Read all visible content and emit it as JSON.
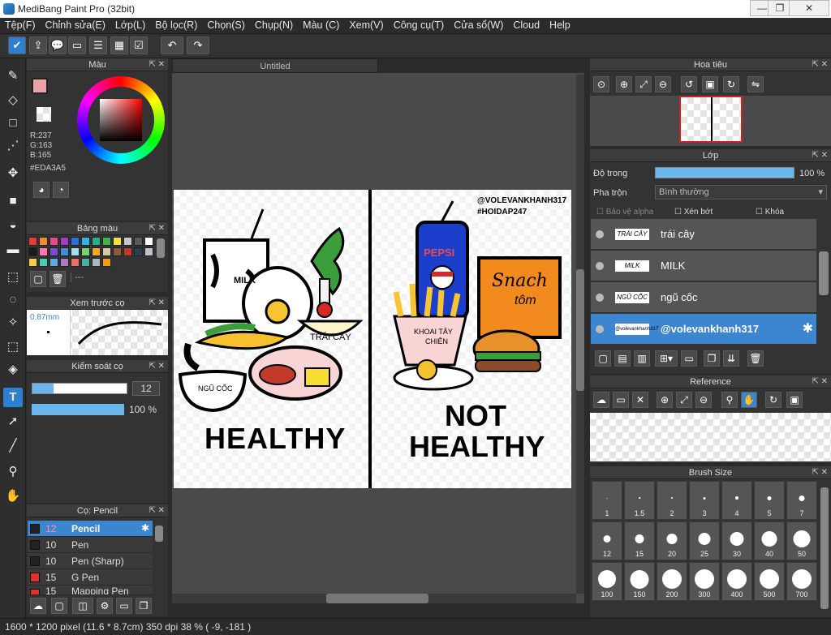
{
  "app": {
    "title": "MediBang Paint Pro (32bit)"
  },
  "menu": [
    "Tệp(F)",
    "Chỉnh sửa(E)",
    "Lớp(L)",
    "Bộ lọc(R)",
    "Chọn(S)",
    "Chụp(N)",
    "Màu (C)",
    "Xem(V)",
    "Công cụ(T)",
    "Cửa sổ(W)",
    "Cloud",
    "Help"
  ],
  "color_panel": {
    "title": "Màu",
    "r": "R:237",
    "g": "G:163",
    "b": "B:165",
    "hex": "#EDA3A5",
    "fg": "#EDA3A5"
  },
  "palette_panel": {
    "title": "Bảng màu",
    "dash": "---",
    "swatches": [
      "#e63b3b",
      "#f28a2e",
      "#e84b8a",
      "#9b3fc4",
      "#2d6fd6",
      "#2bb5e8",
      "#26b08a",
      "#3bb54a",
      "#f5e33b",
      "#c7c7c7",
      "#5a5a5a",
      "#ffffff",
      "#1a1a1a",
      "#ff7ab0",
      "#7a4bd6",
      "#3b8fd8",
      "#9fe0f0",
      "#77d177",
      "#f5a623",
      "#d4c8a0",
      "#8a5a3a",
      "#c0392b",
      "#2c3e50",
      "#bdc3c7",
      "#f4d03f",
      "#48c9b0",
      "#5dade2",
      "#af7ac5",
      "#ec7063",
      "#45b39d",
      "#aab7b8",
      "#f39c12"
    ]
  },
  "preview_panel": {
    "title": "Xem trước cọ",
    "size": "0.87mm"
  },
  "control_panel": {
    "title": "Kiểm soát cọ",
    "size": "12",
    "opacity": "100 %"
  },
  "brush_panel": {
    "title": "Cọ: Pencil",
    "items": [
      {
        "size": "12",
        "name": "Pencil",
        "color": "#222222",
        "selected": true
      },
      {
        "size": "10",
        "name": "Pen",
        "color": "#222222"
      },
      {
        "size": "10",
        "name": "Pen (Sharp)",
        "color": "#222222"
      },
      {
        "size": "15",
        "name": "G Pen",
        "color": "#e03030"
      },
      {
        "size": "15",
        "name": "Mapping Pen",
        "color": "#e03030"
      }
    ]
  },
  "document": {
    "tab": "Untitled",
    "healthy": "HEALTHY",
    "not_healthy_1": "NOT",
    "not_healthy_2": "HEALTHY",
    "handle_1": "@VOLEVANKHANH317",
    "handle_2": "#HOIDAP247",
    "milk": "MILK",
    "trai_cay": "TRÁI CÂY",
    "ngu_coc": "NGŨ CỐC",
    "pepsi": "PEPSI",
    "khoai_1": "KHOAI TÂY",
    "khoai_2": "CHIÊN",
    "snach": "Snach",
    "tom": "tôm"
  },
  "navigator": {
    "title": "Hoa tiêu"
  },
  "layer_panel": {
    "title": "Lớp",
    "opacity_label": "Độ trong",
    "opacity_value": "100 %",
    "blend_label": "Pha trộn",
    "blend_value": "Bình thường",
    "protect_alpha": "Bảo vệ alpha",
    "clipping": "Xén bớt",
    "lock": "Khóa",
    "layers": [
      {
        "name": "trái cây",
        "thumb": "TRÁI CÂY"
      },
      {
        "name": "MILK",
        "thumb": "MILK"
      },
      {
        "name": "ngũ cốc",
        "thumb": "NGŨ CỐC"
      },
      {
        "name": "@volevankhanh317",
        "thumb": "@volevankhanh317",
        "selected": true
      }
    ]
  },
  "reference_panel": {
    "title": "Reference"
  },
  "brushsize_panel": {
    "title": "Brush Size",
    "sizes": [
      "1",
      "1.5",
      "2",
      "3",
      "4",
      "5",
      "7",
      "12",
      "15",
      "20",
      "25",
      "30",
      "40",
      "50",
      "100",
      "150",
      "200",
      "300",
      "400",
      "500",
      "700"
    ]
  },
  "status": "1600 * 1200 pixel   (11.6 * 8.7cm)   350 dpi   38 %   ( -9, -181 )"
}
